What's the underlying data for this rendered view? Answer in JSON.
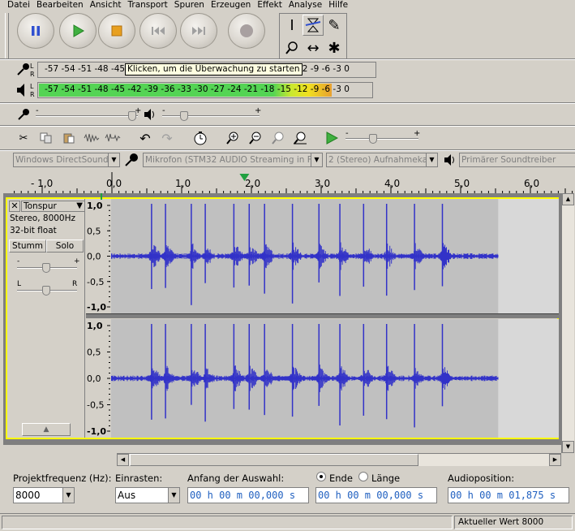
{
  "menu": [
    "Datei",
    "Bearbeiten",
    "Ansicht",
    "Transport",
    "Spuren",
    "Erzeugen",
    "Effekt",
    "Analyse",
    "Hilfe"
  ],
  "transport": {
    "pause": "pause-icon",
    "play": "play-icon",
    "stop": "stop-icon",
    "skip_start": "skip-start-icon",
    "skip_end": "skip-end-icon",
    "record": "record-icon"
  },
  "tools": [
    "I-beam",
    "envelope",
    "pencil",
    "zoom",
    "timeshift",
    "multi"
  ],
  "meters": {
    "scale": "-57 -54 -51 -48 -45 -42 -39 -36 -33 -30 -27 -24 -21 -18 -15 -12 -9 -6 -3 0",
    "tooltip": "Klicken, um die Überwachung zu starten",
    "record_label": "L R",
    "play_label": "L R",
    "play_level_fraction": 0.88,
    "colors": {
      "green": "#54d454",
      "yellow": "#f0e020",
      "orange": "#e8a030"
    }
  },
  "mixer": {
    "mic_level": 0.95,
    "output_level": 0.2
  },
  "playspeed": {
    "level": 0.36
  },
  "devices": {
    "host": "Windows DirectSound",
    "input": "Mikrofon (STM32 AUDIO Streaming in FS M",
    "channels": "2 (Stereo) Aufnahmekan",
    "output": "Primärer Soundtreiber"
  },
  "ruler": {
    "labels": [
      "- 1,0",
      "0,0",
      "1,0",
      "2,0",
      "3,0",
      "4,0",
      "5,0",
      "6,0"
    ],
    "playhead_seconds": 1.9
  },
  "track": {
    "name": "Tonspur",
    "info1": "Stereo, 8000Hz",
    "info2": "32-bit float",
    "mute": "Stumm",
    "solo": "Solo",
    "gain_minus": "-",
    "gain_plus": "+",
    "pan_l": "L",
    "pan_r": "R",
    "yticks": [
      "1,0",
      "0,5",
      "0,0",
      "-0,5",
      "-1,0"
    ],
    "duration_seconds": 5.55,
    "impulses_seconds": [
      0.58,
      0.78,
      1.15,
      1.35,
      1.76,
      1.98,
      2.2,
      2.6,
      2.98,
      3.28,
      3.62,
      3.95,
      4.35,
      4.75
    ]
  },
  "bottom": {
    "rate_label": "Projektfrequenz (Hz):",
    "rate_value": "8000",
    "snap_label": "Einrasten:",
    "snap_value": "Aus",
    "sel_start_label": "Anfang der Auswahl:",
    "end_label": "Ende",
    "length_label": "Länge",
    "audiopos_label": "Audioposition:",
    "sel_start": "00 h 00 m 00,000 s",
    "sel_end": "00 h 00 m 00,000 s",
    "audio_pos": "00 h 00 m 01,875 s"
  },
  "status": "Aktueller Wert 8000",
  "accent": {
    "wave": "#3232c8",
    "selection_border": "#ffff00",
    "playhead": "#20a040"
  }
}
